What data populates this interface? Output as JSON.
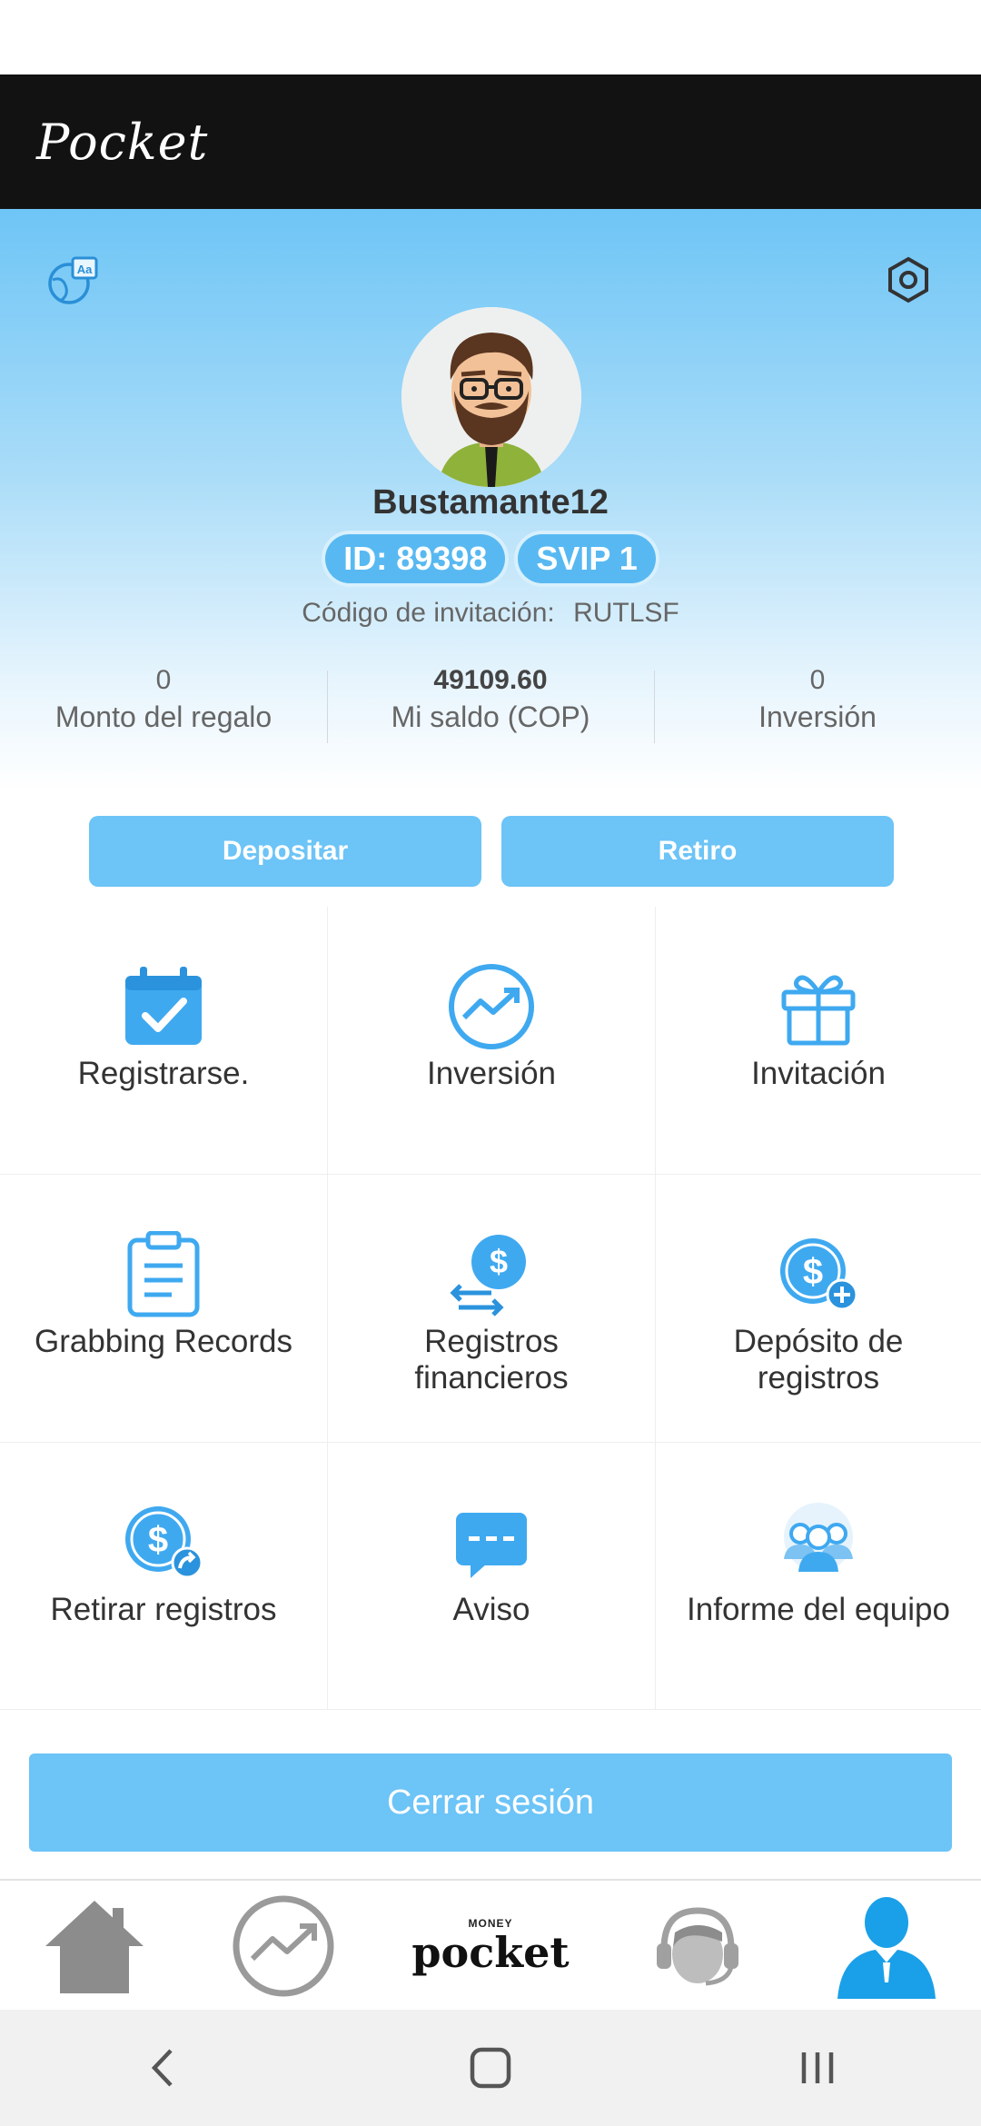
{
  "app_title": "Pocket",
  "profile": {
    "username": "Bustamante12",
    "id_badge": "ID: 89398",
    "vip_badge": "SVIP 1",
    "invite_label": "Código de invitación:",
    "invite_code": "RUTLSF"
  },
  "stats": [
    {
      "value": "0",
      "label": "Monto del regalo"
    },
    {
      "value": "49109.60",
      "label": "Mi saldo (COP)"
    },
    {
      "value": "0",
      "label": "Inversión"
    }
  ],
  "actions": {
    "deposit": "Depositar",
    "withdraw": "Retiro"
  },
  "grid": [
    {
      "label": "Registrarse.",
      "icon": "calendar-check-icon"
    },
    {
      "label": "Inversión",
      "icon": "trend-chart-icon"
    },
    {
      "label": "Invitación",
      "icon": "gift-icon"
    },
    {
      "label": "Grabbing Records",
      "icon": "clipboard-icon"
    },
    {
      "label": "Registros\nfinancieros",
      "icon": "money-transfer-icon"
    },
    {
      "label": "Depósito de\nregistros",
      "icon": "money-plus-icon"
    },
    {
      "label": "Retirar registros",
      "icon": "money-withdraw-icon"
    },
    {
      "label": "Aviso",
      "icon": "message-icon"
    },
    {
      "label": "Informe del equipo",
      "icon": "team-icon"
    }
  ],
  "logout": "Cerrar sesión",
  "bottom_nav": {
    "logo_small": "MONEY",
    "logo_main": "pocket"
  },
  "colors": {
    "accent": "#6cc4f7",
    "icon_blue": "#3fa9f0",
    "appbar": "#121212"
  }
}
